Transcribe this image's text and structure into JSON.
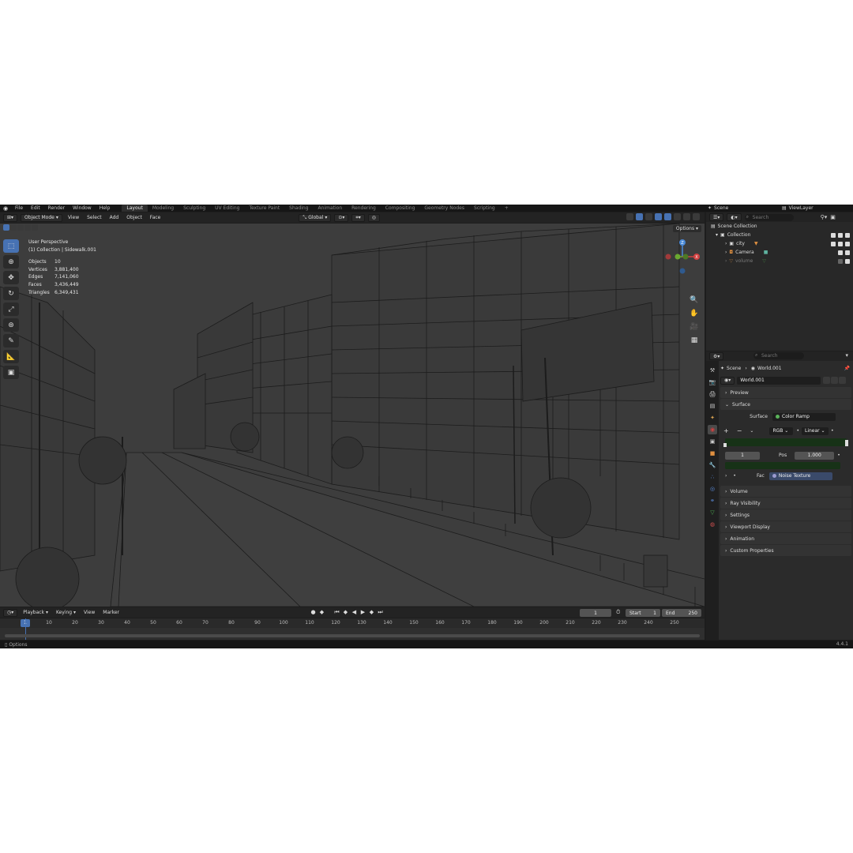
{
  "menu": [
    "File",
    "Edit",
    "Render",
    "Window",
    "Help"
  ],
  "workspaces": [
    "Layout",
    "Modeling",
    "Sculpting",
    "UV Editing",
    "Texture Paint",
    "Shading",
    "Animation",
    "Rendering",
    "Compositing",
    "Geometry Nodes",
    "Scripting",
    "+"
  ],
  "active_workspace": "Layout",
  "scene_name": "Scene",
  "view_layer": "ViewLayer",
  "viewport_header": {
    "mode": "Object Mode",
    "view": "View",
    "select": "Select",
    "add": "Add",
    "object": "Object",
    "face": "Face",
    "transform_orientation": "Global"
  },
  "viewport": {
    "perspective": "User Perspective",
    "active": "(1) Collection | Sidewalk.001",
    "options": "Options",
    "stats": [
      {
        "label": "Objects",
        "value": "10"
      },
      {
        "label": "Vertices",
        "value": "3,881,400"
      },
      {
        "label": "Edges",
        "value": "7,141,060"
      },
      {
        "label": "Faces",
        "value": "3,436,449"
      },
      {
        "label": "Triangles",
        "value": "6,349,431"
      }
    ]
  },
  "gizmo_axes": {
    "x": "X",
    "y": "Y",
    "z": "Z"
  },
  "timeline": {
    "playback": "Playback",
    "keying": "Keying",
    "view": "View",
    "marker": "Marker",
    "current_frame": "1",
    "start_label": "Start",
    "start": "1",
    "end_label": "End",
    "end": "250",
    "ticks": [
      "1",
      "10",
      "20",
      "30",
      "40",
      "50",
      "60",
      "70",
      "80",
      "90",
      "100",
      "110",
      "120",
      "130",
      "140",
      "150",
      "160",
      "170",
      "180",
      "190",
      "200",
      "210",
      "220",
      "230",
      "240",
      "250"
    ]
  },
  "status": {
    "left": "Options",
    "version": "4.4.1"
  },
  "outliner": {
    "search_placeholder": "Search",
    "root": "Scene Collection",
    "items": [
      {
        "label": "Collection",
        "level": 1
      },
      {
        "label": "city",
        "level": 2
      },
      {
        "label": "Camera",
        "level": 2
      },
      {
        "label": "volume",
        "level": 2
      }
    ]
  },
  "properties": {
    "search_placeholder": "Search",
    "breadcrumb_scene": "Scene",
    "breadcrumb_world": "World.001",
    "world_name": "World.001",
    "panels": {
      "preview": "Preview",
      "surface": "Surface",
      "volume": "Volume",
      "ray_visibility": "Ray Visibility",
      "settings": "Settings",
      "viewport_display": "Viewport Display",
      "animation": "Animation",
      "custom_properties": "Custom Properties"
    },
    "surface_label": "Surface",
    "surface_value": "Color Ramp",
    "color_mode": "RGB",
    "interpolation": "Linear",
    "stop_index": "1",
    "pos_label": "Pos",
    "pos_value": "1.000",
    "fac_label": "Fac",
    "fac_value": "Noise Texture",
    "ramp_color": "#173217"
  }
}
